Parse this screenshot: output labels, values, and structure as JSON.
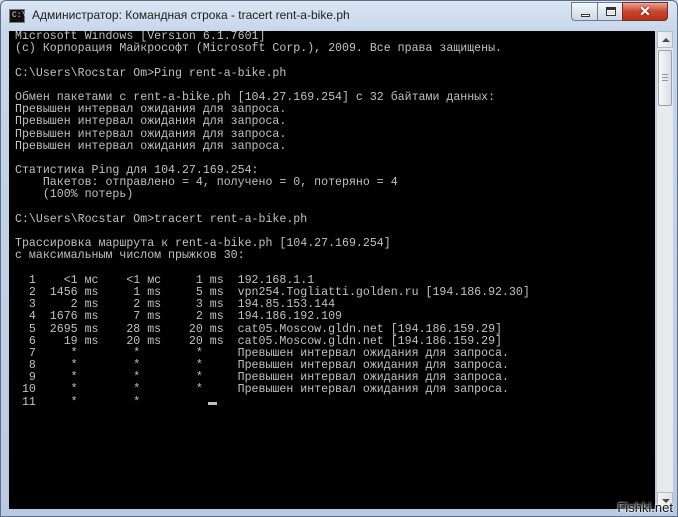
{
  "window": {
    "title": "Администратор: Командная строка - tracert  rent-a-bike.ph",
    "app_icon_text": "C:\\",
    "controls": {
      "close_glyph": "✕"
    }
  },
  "console": {
    "lines": [
      "Microsoft Windows [Version 6.1.7601]",
      "(c) Корпорация Майкрософт (Microsoft Corp.), 2009. Все права защищены.",
      "",
      "C:\\Users\\Rocstar Om>Ping rent-a-bike.ph",
      "",
      "Обмен пакетами с rent-a-bike.ph [104.27.169.254] с 32 байтами данных:",
      "Превышен интервал ожидания для запроса.",
      "Превышен интервал ожидания для запроса.",
      "Превышен интервал ожидания для запроса.",
      "Превышен интервал ожидания для запроса.",
      "",
      "Статистика Ping для 104.27.169.254:",
      "    Пакетов: отправлено = 4, получено = 0, потеряно = 4",
      "    (100% потерь)",
      "",
      "C:\\Users\\Rocstar Om>tracert rent-a-bike.ph",
      "",
      "Трассировка маршрута к rent-a-bike.ph [104.27.169.254]",
      "с максимальным числом прыжков 30:",
      "",
      "  1    <1 мс    <1 мс     1 ms  192.168.1.1",
      "  2  1456 ms     1 ms     5 ms  vpn254.Togliatti.golden.ru [194.186.92.30]",
      "  3     2 ms     2 ms     3 ms  194.85.153.144",
      "  4  1676 ms     7 ms     2 ms  194.186.192.109",
      "  5  2695 ms    28 ms    20 ms  cat05.Moscow.gldn.net [194.186.159.29]",
      "  6    19 ms    20 ms    20 ms  cat05.Moscow.gldn.net [194.186.159.29]",
      "  7     *        *        *     Превышен интервал ожидания для запроса.",
      "  8     *        *        *     Превышен интервал ожидания для запроса.",
      "  9     *        *        *     Превышен интервал ожидания для запроса.",
      " 10     *        *        *     Превышен интервал ожидания для запроса.",
      " 11     *        *"
    ]
  },
  "watermark": "Fishki.net"
}
